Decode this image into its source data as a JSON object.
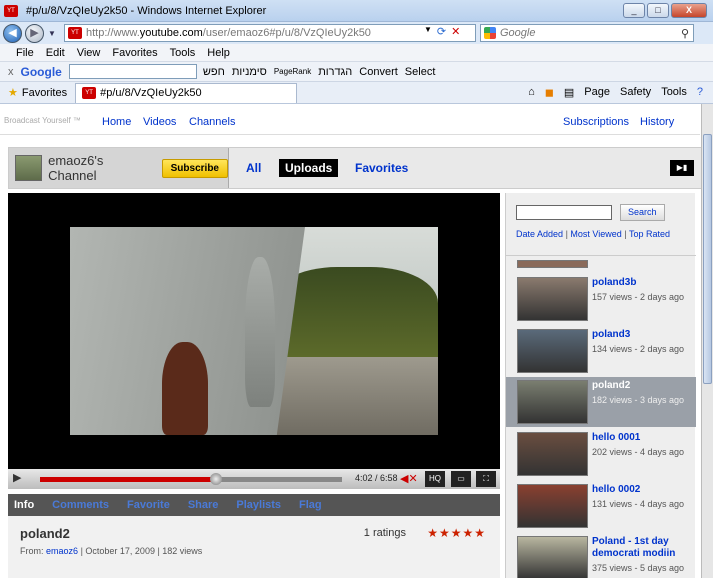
{
  "window": {
    "title": "#p/u/8/VzQIeUy2k50 - Windows Internet Explorer",
    "controls": [
      "_",
      "□",
      "X"
    ]
  },
  "address": {
    "prefix": "http://www.",
    "domain": "youtube.com",
    "path": "/user/emaoz6#p/u/8/VzQIeUy2k50"
  },
  "search": {
    "placeholder": "Google"
  },
  "menu": [
    "File",
    "Edit",
    "View",
    "Favorites",
    "Tools",
    "Help"
  ],
  "google_toolbar": {
    "brand": "Google",
    "items": [
      "חפש",
      "סימניות",
      "PageRank",
      "הגדרות",
      "Convert",
      "Select"
    ]
  },
  "favorites": {
    "label": "Favorites",
    "tab": "#p/u/8/VzQIeUy2k50",
    "commands": [
      "Page",
      "Safety",
      "Tools"
    ]
  },
  "youtube": {
    "tagline": "Broadcast Yourself ™",
    "nav": [
      "Home",
      "Videos",
      "Channels"
    ],
    "nav_right": [
      "Subscriptions",
      "History"
    ]
  },
  "channel": {
    "name": "emaoz6's Channel",
    "subscribe": "Subscribe",
    "tabs": [
      "All",
      "Uploads",
      "Favorites"
    ]
  },
  "player": {
    "time": "4:02 / 6:58",
    "hq": "HQ",
    "progress": 0.58
  },
  "info_tabs": [
    "Info",
    "Comments",
    "Favorite",
    "Share",
    "Playlists",
    "Flag"
  ],
  "video": {
    "title": "poland2",
    "from_label": "From:",
    "from_user": "emaoz6",
    "date_views": "| October 17, 2009 | 182 views",
    "ratings": "1 ratings",
    "stars": "★★★★★"
  },
  "sidebar": {
    "search_button": "Search",
    "sort_date": "Date Added",
    "sort_viewed": "Most Viewed",
    "sort_rated": "Top Rated",
    "sep": "|",
    "videos": [
      {
        "title": "poland3b",
        "meta": "157 views - 2 days ago",
        "color": "#8a7a6e"
      },
      {
        "title": "poland3",
        "meta": "134 views - 2 days ago",
        "color": "#5a6a7a"
      },
      {
        "title": "poland2",
        "meta": "182 views - 3 days ago",
        "color": "#7a7e70"
      },
      {
        "title": "hello 0001",
        "meta": "202 views - 4 days ago",
        "color": "#6a4e40"
      },
      {
        "title": "hello 0002",
        "meta": "131 views - 4 days ago",
        "color": "#8a4030"
      },
      {
        "title": "Poland - 1st day democrati modiin",
        "meta": "375 views - 5 days ago",
        "color": "#b8b6a0"
      }
    ]
  }
}
